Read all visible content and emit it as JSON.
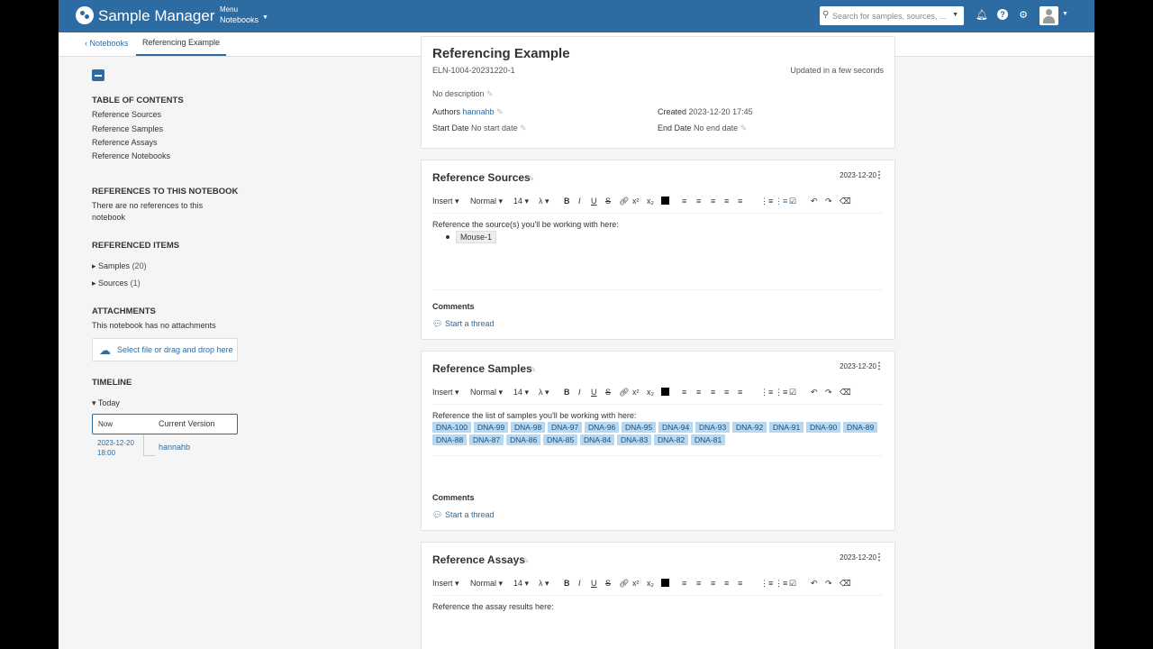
{
  "navbar": {
    "brand": "Sample Manager",
    "menu_label": "Menu",
    "menu_value": "Notebooks",
    "search_placeholder": "Search for samples, sources, ..."
  },
  "breadcrumb": {
    "back": "Notebooks",
    "current": "Referencing Example"
  },
  "sidebar": {
    "toc_heading": "TABLE OF CONTENTS",
    "toc_items": [
      "Reference Sources",
      "Reference Samples",
      "Reference Assays",
      "Reference Notebooks"
    ],
    "refs_heading": "REFERENCES TO THIS NOTEBOOK",
    "refs_text": "There are no references to this notebook",
    "refs_text_line1": "There are no references to this",
    "refs_text_line2": "notebook",
    "referenced_heading": "REFERENCED ITEMS",
    "referenced_items": [
      {
        "label": "Samples",
        "count": "(20)"
      },
      {
        "label": "Sources",
        "count": "(1)"
      }
    ],
    "attachments_heading": "ATTACHMENTS",
    "attachments_text": "This notebook has no attachments",
    "upload_label": "Select file or drag and drop here",
    "timeline_heading": "TIMELINE",
    "timeline_group": "Today",
    "timeline_now": "Now",
    "timeline_current": "Current Version",
    "timeline_date": "2023-12-20",
    "timeline_time": "18:00",
    "timeline_user": "hannahb"
  },
  "header_card": {
    "title": "Referencing Example",
    "eln_id": "ELN-1004-20231220-1",
    "updated": "Updated in a few seconds",
    "description": "No description",
    "authors_label": "Authors",
    "authors_value": "hannahb",
    "created_label": "Created",
    "created_value": "2023-12-20 17:45",
    "start_label": "Start Date",
    "start_value": "No start date",
    "end_label": "End Date",
    "end_value": "No end date"
  },
  "toolbar": {
    "insert": "Insert",
    "style": "Normal",
    "size": "14",
    "lambda": "λ",
    "bold": "B",
    "italic": "I",
    "underline": "U",
    "strike": "S",
    "sup": "x²",
    "sub": "x₂"
  },
  "cards": [
    {
      "title": "Reference Sources",
      "date": "2023-12-20",
      "body": "Reference the source(s) you'll be working with here:",
      "chips": [
        "Mouse-1"
      ],
      "comments": "Comments",
      "thread": "Start a thread"
    },
    {
      "title": "Reference Samples",
      "date": "2023-12-20",
      "body": "Reference the list of samples you'll be working with here:",
      "chips": [
        "DNA-100",
        "DNA-99",
        "DNA-98",
        "DNA-97",
        "DNA-96",
        "DNA-95",
        "DNA-94",
        "DNA-93",
        "DNA-92",
        "DNA-91",
        "DNA-90",
        "DNA-89",
        "DNA-88",
        "DNA-87",
        "DNA-86",
        "DNA-85",
        "DNA-84",
        "DNA-83",
        "DNA-82",
        "DNA-81"
      ],
      "comments": "Comments",
      "thread": "Start a thread"
    },
    {
      "title": "Reference Assays",
      "date": "2023-12-20",
      "body": "Reference the assay results here:"
    }
  ],
  "colors": {
    "primary": "#2d6ca2",
    "chip": "#b8d8f0"
  }
}
